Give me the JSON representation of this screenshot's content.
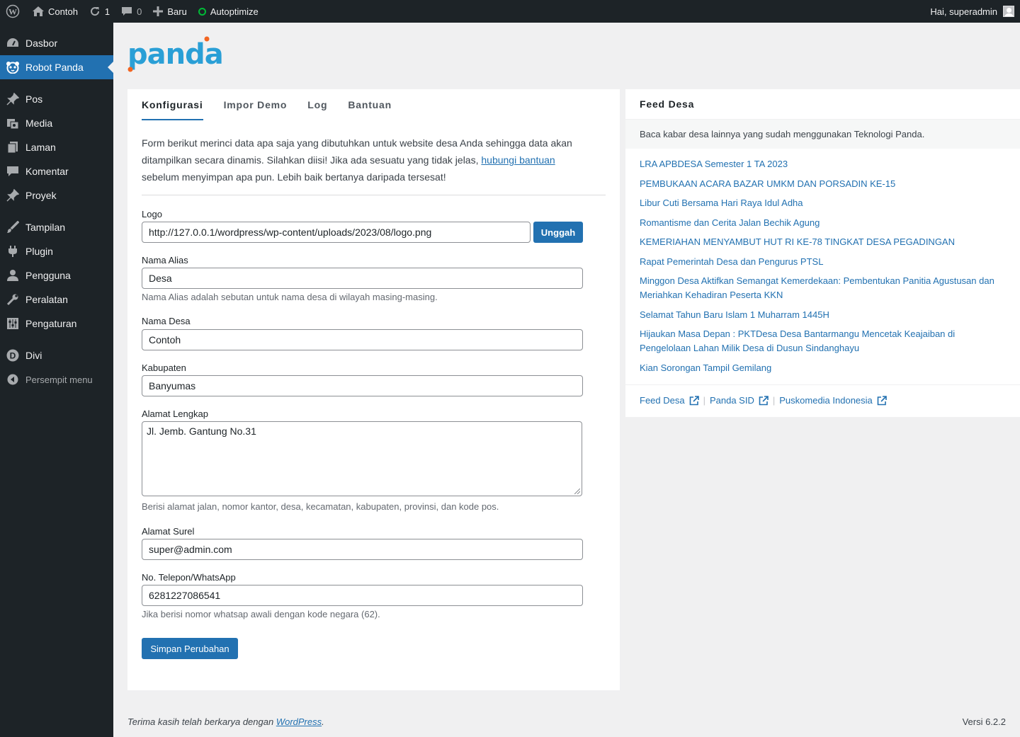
{
  "adminbar": {
    "site_name": "Contoh",
    "updates_count": "1",
    "comments_count": "0",
    "new_label": "Baru",
    "autoptimize_label": "Autoptimize",
    "greeting": "Hai, superadmin"
  },
  "sidebar": {
    "items": [
      {
        "label": "Dasbor",
        "icon": "dashboard-icon"
      },
      {
        "label": "Robot Panda",
        "icon": "panda-icon"
      },
      {
        "label": "Pos",
        "icon": "pin-icon"
      },
      {
        "label": "Media",
        "icon": "media-icon"
      },
      {
        "label": "Laman",
        "icon": "page-icon"
      },
      {
        "label": "Komentar",
        "icon": "comment-icon"
      },
      {
        "label": "Proyek",
        "icon": "pin-icon"
      },
      {
        "label": "Tampilan",
        "icon": "brush-icon"
      },
      {
        "label": "Plugin",
        "icon": "plugin-icon"
      },
      {
        "label": "Pengguna",
        "icon": "user-icon"
      },
      {
        "label": "Peralatan",
        "icon": "wrench-icon"
      },
      {
        "label": "Pengaturan",
        "icon": "settings-icon"
      },
      {
        "label": "Divi",
        "icon": "divi-icon"
      }
    ],
    "collapse_label": "Persempit menu"
  },
  "logo_text": "panda",
  "tabs": [
    "Konfigurasi",
    "Impor Demo",
    "Log",
    "Bantuan"
  ],
  "intro": {
    "text_before": "Form berikut merinci data apa saja yang dibutuhkan untuk website desa Anda sehingga data akan ditampilkan secara dinamis. Silahkan diisi! Jika ada sesuatu yang tidak jelas, ",
    "link": "hubungi bantuan",
    "text_after": " sebelum menyimpan apa pun. Lebih baik bertanya daripada tersesat!"
  },
  "form": {
    "logo_label": "Logo",
    "logo_value": "http://127.0.0.1/wordpress/wp-content/uploads/2023/08/logo.png",
    "upload_button": "Unggah",
    "alias_label": "Nama Alias",
    "alias_value": "Desa",
    "alias_desc": "Nama Alias adalah sebutan untuk nama desa di wilayah masing-masing.",
    "village_label": "Nama Desa",
    "village_value": "Contoh",
    "regency_label": "Kabupaten",
    "regency_value": "Banyumas",
    "address_label": "Alamat Lengkap",
    "address_value": "Jl. Jemb. Gantung No.31",
    "address_desc": "Berisi alamat jalan, nomor kantor, desa, kecamatan, kabupaten, provinsi, dan kode pos.",
    "email_label": "Alamat Surel",
    "email_value": "super@admin.com",
    "phone_label": "No. Telepon/WhatsApp",
    "phone_value": "6281227086541",
    "phone_desc": "Jika berisi nomor whatsap awali dengan kode negara (62).",
    "save_button": "Simpan Perubahan"
  },
  "feed": {
    "title": "Feed Desa",
    "subtitle": "Baca kabar desa lainnya yang sudah menggunakan Teknologi Panda.",
    "items": [
      "LRA APBDESA Semester 1 TA 2023",
      "PEMBUKAAN ACARA BAZAR UMKM DAN PORSADIN KE-15",
      "Libur Cuti Bersama Hari Raya Idul Adha",
      "Romantisme dan Cerita Jalan Bechik Agung",
      "KEMERIAHAN MENYAMBUT HUT RI KE-78 TINGKAT DESA PEGADINGAN",
      "Rapat Pemerintah Desa dan Pengurus PTSL",
      "Minggon Desa Aktifkan Semangat Kemerdekaan: Pembentukan Panitia Agustusan dan Meriahkan Kehadiran Peserta KKN",
      "Selamat Tahun Baru Islam 1 Muharram 1445H",
      "Hijaukan Masa Depan : PKTDesa Desa Bantarmangu Mencetak Keajaiban di Pengelolaan Lahan Milik Desa di Dusun Sindanghayu",
      "Kian Sorongan Tampil Gemilang"
    ],
    "links": [
      "Feed Desa",
      "Panda SID",
      "Puskomedia Indonesia"
    ]
  },
  "footer": {
    "text": "Terima kasih telah berkarya dengan ",
    "link": "WordPress",
    "version": "Versi 6.2.2"
  }
}
